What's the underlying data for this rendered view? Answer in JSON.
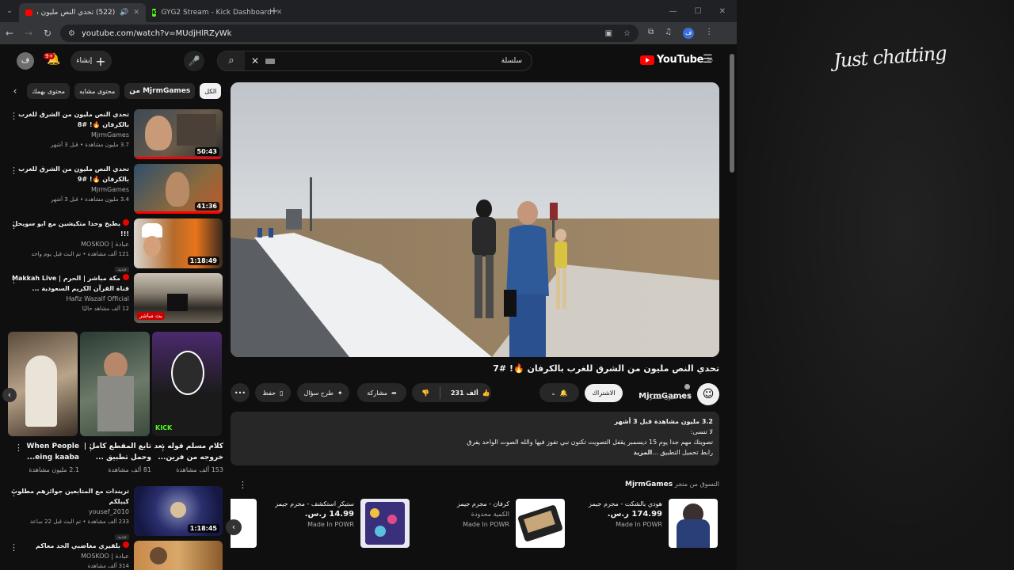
{
  "browser": {
    "tabs": [
      {
        "title": "(522) تحدي النص مليون من",
        "active": true
      },
      {
        "title": "GYG2 Stream - Kick Dashboard",
        "active": false
      }
    ],
    "url": "youtube.com/watch?v=MUdjHlRZyWk",
    "profile_initial": "ف"
  },
  "youtube": {
    "logo_text": "YouTube",
    "region": "SA",
    "search_query": "سلسلة",
    "create_label": "إنشاء",
    "notification_count": "9+",
    "avatar_initial": "ف"
  },
  "sidebar": {
    "chips": [
      "الكل",
      "من MjrmGames",
      "محتوى مشابه",
      "محتوى يهمك"
    ],
    "videos": [
      {
        "title": "تحدي النص مليون من الشرق للغرب بالكرفان 🔥! #8",
        "channel": "MjrmGames",
        "stats": "3.7 مليون مشاهدة • قبل 3 أشهر",
        "duration": "50:43"
      },
      {
        "title": "تحدي النص مليون من الشرق للغرب بالكرفان 🔥! #9",
        "channel": "MjrmGames",
        "stats": "3.4 مليون مشاهدة • قبل 3 أشهر",
        "duration": "41:36"
      },
      {
        "title": "يطبخ وحدا متكيشين مع ابو سويحل !!!",
        "channel": "عبادة | MOSKOO",
        "stats": "121 ألف مشاهدة • تم البث قبل يوم واحد",
        "badge": "جديد",
        "duration": "1:18:49"
      },
      {
        "title": "مكة مباشر | الحرم | Makkah Live قناة القرآن الكريم السعودية ...",
        "channel": "Hafiz Wazalf Official",
        "stats": "12 ألف مشاهد حاليًا",
        "live": "بث مباشر"
      }
    ],
    "shorts": [
      {
        "title": "كلام مسلم قوله بعد خروجه من فرين...",
        "views": "153 ألف مشاهدة"
      },
      {
        "title": "تابع المقطع كامل | وحمل تطبيق ...",
        "views": "81 ألف مشاهدة"
      },
      {
        "title": "When People ...eing kaaba",
        "views": "2.1 مليون مشاهدة"
      }
    ],
    "videos2": [
      {
        "title": "تريندات مع المتابعين جوائزهم مطلوب كيبلكم",
        "channel": "yousef_2010",
        "stats": "233 ألف مشاهدة • تم البث قبل 22 ساعة",
        "badge": "جديد",
        "duration": "1:18:45"
      },
      {
        "title": "بلقيري مغاضبي الحد معاكم",
        "channel": "عبادة | MOSKOO",
        "stats": "314 ألف مشاهدة"
      }
    ],
    "kick_label": "KICK"
  },
  "video": {
    "title": "تحدي النص مليون من الشرق للغرب بالكرفان 🔥! #7",
    "channel": "MjrmGames",
    "subscribers": "11.3 مليون مشترك",
    "subscribe_label": "الاشتراك",
    "likes": "231 ألف",
    "share_label": "مشاركة",
    "ask_label": "طرح سؤال",
    "save_label": "حفظ"
  },
  "description": {
    "views_date": "3.2 مليون مشاهدة  قبل 3 أشهر",
    "line1": "لا تنسى:",
    "line2": "تصويتك مهم جدا يوم 15 ديسمبر يقفل التصويت تكنون نبي تفوز فيها والله الصوت الواحد يفرق",
    "line3": "رابط تحميل التطبيق ...",
    "more": "المزيد"
  },
  "shop": {
    "heading_prefix": "التسوق من متجر",
    "heading_channel": "MjrmGames",
    "products": [
      {
        "name": "هودي بالشكت - مجرم جيمز",
        "price": "174.99 ر.س.",
        "stock": "",
        "made_in": "Made In POWR"
      },
      {
        "name": "كرفان - مجرم جيمز",
        "price": "",
        "stock": "الكمية محدودة",
        "made_in": "Made In POWR"
      },
      {
        "name": "ستيكر استكشف - مجرم جيمز",
        "price": "14.99 ر.س.",
        "stock": "",
        "made_in": "Made In POWR"
      }
    ]
  },
  "overlay": {
    "text": "Just chatting"
  },
  "colors": {
    "bg": "#0f0f0f",
    "yt_red": "#ff0000",
    "kick_green": "#53fc18",
    "chip_bg": "#272727"
  }
}
